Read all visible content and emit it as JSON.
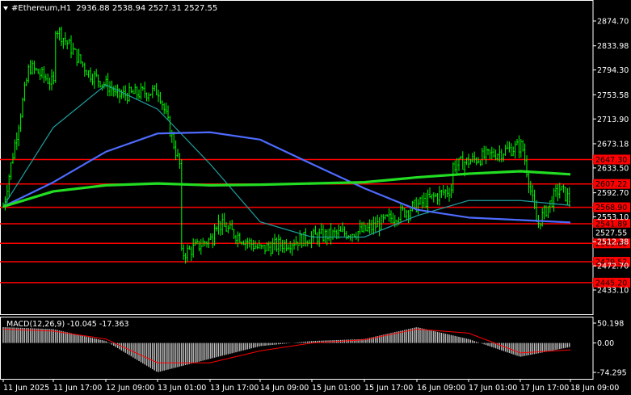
{
  "header": {
    "menu_icon": "triangle-down-icon",
    "symbol": "#Ethereum,H1",
    "ohlc": "2936.88 2538.94 2527.31 2527.55"
  },
  "colors": {
    "background": "#000000",
    "candle": "#00ff00",
    "ma_fast": "#20a0a0",
    "ma_mid": "#4d6bff",
    "ma_slow": "#22dd22",
    "level_line": "#ff0000",
    "macd_histogram": "#c0c0c0",
    "macd_signal": "#ff0000",
    "axis_text": "#ffffff"
  },
  "price_axis_ticks": [
    "2874.70",
    "2833.98",
    "2794.30",
    "2753.58",
    "2713.90",
    "2673.18",
    "2633.50",
    "2592.70",
    "2553.10",
    "2512.38",
    "2472.70",
    "2433.10"
  ],
  "levels": [
    {
      "label": "2647.30",
      "value": 2647.3
    },
    {
      "label": "2607.22",
      "value": 2607.22
    },
    {
      "label": "2568.90",
      "value": 2568.9
    },
    {
      "label": "2541.89",
      "value": 2541.89
    },
    {
      "label": "2509.66",
      "value": 2509.66
    },
    {
      "label": "2479.52",
      "value": 2479.52
    },
    {
      "label": "2445.20",
      "value": 2445.2
    }
  ],
  "current_price": {
    "label": "2527.55",
    "value": 2527.55
  },
  "time_axis_labels": [
    "11 Jun 2025",
    "11 Jun 17:00",
    "12 Jun 09:00",
    "13 Jun 01:00",
    "13 Jun 17:00",
    "14 Jun 09:00",
    "15 Jun 01:00",
    "15 Jun 17:00",
    "16 Jun 09:00",
    "17 Jun 01:00",
    "17 Jun 17:00",
    "18 Jun 09:00"
  ],
  "macd": {
    "label": "MACD(12,26,9) -10.045 -17.363",
    "axis_ticks": [
      "50.198",
      "0.00",
      "-74.295"
    ]
  },
  "chart_data": {
    "type": "candlestick",
    "title": "#Ethereum,H1",
    "ylim": [
      2433.1,
      2890
    ],
    "close_path": [
      {
        "x": "11 Jun 2025",
        "y": 2570
      },
      {
        "x": "11 Jun 07:00",
        "y": 2800
      },
      {
        "x": "11 Jun 14:00",
        "y": 2770
      },
      {
        "x": "11 Jun 17:00",
        "y": 2870
      },
      {
        "x": "11 Jun 23:00",
        "y": 2790
      },
      {
        "x": "12 Jun 06:00",
        "y": 2760
      },
      {
        "x": "12 Jun 09:00",
        "y": 2750
      },
      {
        "x": "12 Jun 18:00",
        "y": 2760
      },
      {
        "x": "13 Jun 00:00",
        "y": 2630
      },
      {
        "x": "13 Jun 01:00",
        "y": 2470
      },
      {
        "x": "13 Jun 09:00",
        "y": 2520
      },
      {
        "x": "13 Jun 17:00",
        "y": 2550
      },
      {
        "x": "14 Jun 09:00",
        "y": 2500
      },
      {
        "x": "15 Jun 01:00",
        "y": 2520
      },
      {
        "x": "15 Jun 17:00",
        "y": 2530
      },
      {
        "x": "16 Jun 01:00",
        "y": 2600
      },
      {
        "x": "16 Jun 09:00",
        "y": 2620
      },
      {
        "x": "16 Jun 20:00",
        "y": 2670
      },
      {
        "x": "17 Jun 00:00",
        "y": 2540
      },
      {
        "x": "17 Jun 06:00",
        "y": 2600
      },
      {
        "x": "17 Jun 12:00",
        "y": 2560
      },
      {
        "x": "17 Jun 17:00",
        "y": 2460
      },
      {
        "x": "18 Jun 09:00",
        "y": 2527.55
      }
    ],
    "series": [
      {
        "name": "",
        "color": "#20a0a0",
        "values": [
          {
            "x": "11 Jun 2025",
            "y": 2570
          },
          {
            "x": "11 Jun 17:00",
            "y": 2700
          },
          {
            "x": "12 Jun 09:00",
            "y": 2770
          },
          {
            "x": "13 Jun 01:00",
            "y": 2730
          },
          {
            "x": "13 Jun 17:00",
            "y": 2640
          },
          {
            "x": "14 Jun 09:00",
            "y": 2545
          },
          {
            "x": "15 Jun 01:00",
            "y": 2520
          },
          {
            "x": "15 Jun 17:00",
            "y": 2520
          },
          {
            "x": "16 Jun 09:00",
            "y": 2555
          },
          {
            "x": "17 Jun 01:00",
            "y": 2580
          },
          {
            "x": "17 Jun 17:00",
            "y": 2580
          },
          {
            "x": "18 Jun 09:00",
            "y": 2572
          }
        ]
      },
      {
        "name": "",
        "color": "#4d6bff",
        "values": [
          {
            "x": "11 Jun 2025",
            "y": 2570
          },
          {
            "x": "11 Jun 17:00",
            "y": 2610
          },
          {
            "x": "12 Jun 09:00",
            "y": 2660
          },
          {
            "x": "13 Jun 01:00",
            "y": 2690
          },
          {
            "x": "13 Jun 17:00",
            "y": 2692
          },
          {
            "x": "14 Jun 09:00",
            "y": 2680
          },
          {
            "x": "15 Jun 01:00",
            "y": 2640
          },
          {
            "x": "15 Jun 17:00",
            "y": 2600
          },
          {
            "x": "16 Jun 09:00",
            "y": 2565
          },
          {
            "x": "17 Jun 01:00",
            "y": 2552
          },
          {
            "x": "17 Jun 17:00",
            "y": 2548
          },
          {
            "x": "18 Jun 09:00",
            "y": 2544
          }
        ]
      },
      {
        "name": "",
        "color": "#22dd22",
        "values": [
          {
            "x": "11 Jun 2025",
            "y": 2570
          },
          {
            "x": "11 Jun 17:00",
            "y": 2595
          },
          {
            "x": "12 Jun 09:00",
            "y": 2605
          },
          {
            "x": "13 Jun 01:00",
            "y": 2608
          },
          {
            "x": "13 Jun 17:00",
            "y": 2605
          },
          {
            "x": "14 Jun 09:00",
            "y": 2606
          },
          {
            "x": "15 Jun 01:00",
            "y": 2608
          },
          {
            "x": "15 Jun 17:00",
            "y": 2610
          },
          {
            "x": "16 Jun 09:00",
            "y": 2618
          },
          {
            "x": "17 Jun 01:00",
            "y": 2624
          },
          {
            "x": "17 Jun 17:00",
            "y": 2628
          },
          {
            "x": "18 Jun 09:00",
            "y": 2623
          }
        ]
      }
    ],
    "macd_histogram": [
      {
        "x": "11 Jun 2025",
        "y": 40
      },
      {
        "x": "11 Jun 17:00",
        "y": 35
      },
      {
        "x": "12 Jun 09:00",
        "y": 5
      },
      {
        "x": "13 Jun 01:00",
        "y": -74
      },
      {
        "x": "13 Jun 17:00",
        "y": -40
      },
      {
        "x": "14 Jun 09:00",
        "y": -8
      },
      {
        "x": "15 Jun 01:00",
        "y": 5
      },
      {
        "x": "15 Jun 17:00",
        "y": 10
      },
      {
        "x": "16 Jun 09:00",
        "y": 40
      },
      {
        "x": "17 Jun 01:00",
        "y": 10
      },
      {
        "x": "17 Jun 17:00",
        "y": -35
      },
      {
        "x": "18 Jun 09:00",
        "y": -10.045
      }
    ],
    "macd_signal": [
      {
        "x": "11 Jun 2025",
        "y": 35
      },
      {
        "x": "11 Jun 17:00",
        "y": 30
      },
      {
        "x": "12 Jun 09:00",
        "y": 10
      },
      {
        "x": "13 Jun 01:00",
        "y": -50
      },
      {
        "x": "13 Jun 17:00",
        "y": -50
      },
      {
        "x": "14 Jun 09:00",
        "y": -20
      },
      {
        "x": "15 Jun 01:00",
        "y": 0
      },
      {
        "x": "15 Jun 17:00",
        "y": 8
      },
      {
        "x": "16 Jun 09:00",
        "y": 35
      },
      {
        "x": "17 Jun 01:00",
        "y": 25
      },
      {
        "x": "17 Jun 17:00",
        "y": -25
      },
      {
        "x": "18 Jun 09:00",
        "y": -17.363
      }
    ]
  }
}
